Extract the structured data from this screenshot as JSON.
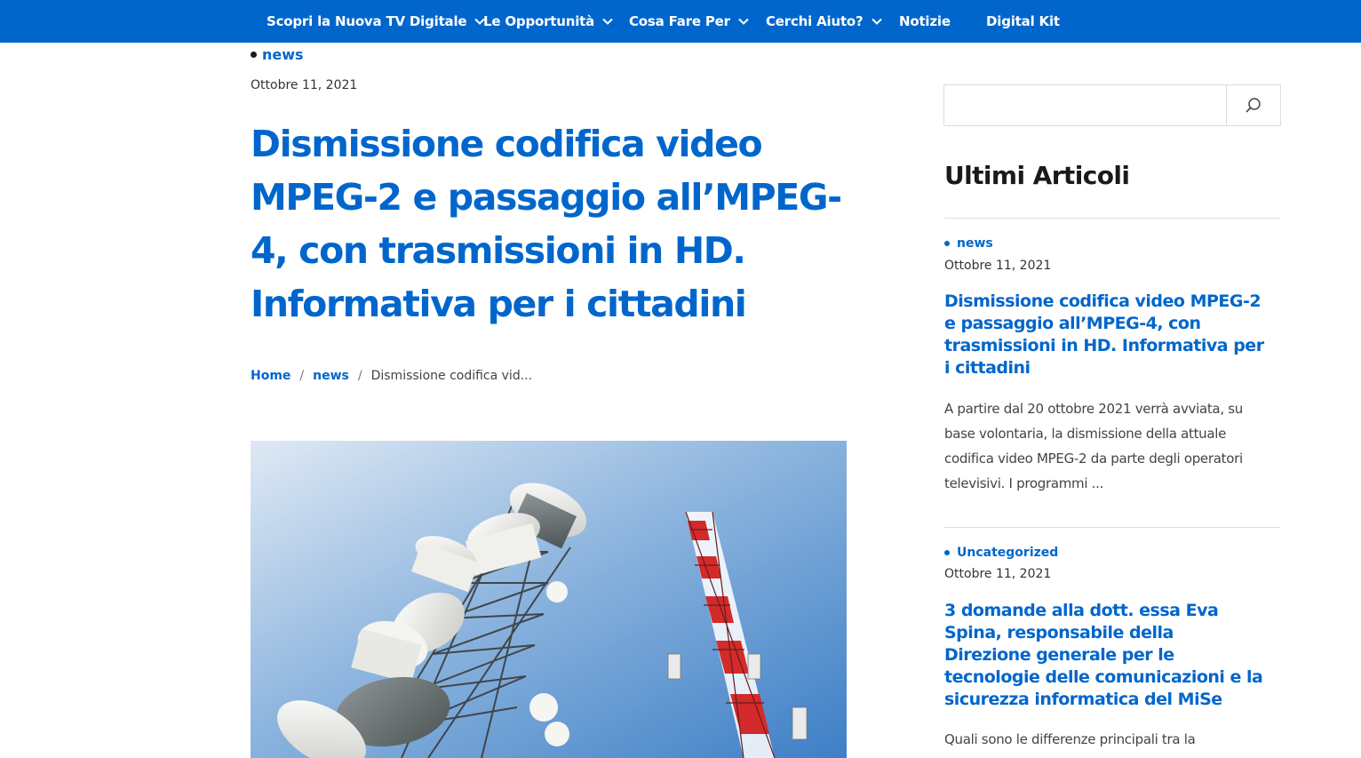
{
  "nav": {
    "items": [
      {
        "label": "Scopri la Nuova TV Digitale",
        "dropdown": true
      },
      {
        "label": "Le Opportunità",
        "dropdown": true
      },
      {
        "label": "Cosa Fare Per",
        "dropdown": true
      },
      {
        "label": "Cerchi Aiuto?",
        "dropdown": true
      },
      {
        "label": "Notizie",
        "dropdown": false
      },
      {
        "label": "Digital Kit",
        "dropdown": false
      }
    ],
    "color": "#0066cc"
  },
  "article": {
    "category": "news",
    "date": "Ottobre 11, 2021",
    "title": "Dismissione codifica video MPEG-2 e passaggio all’MPEG-4, con trasmissioni in HD. Informativa per i cittadini",
    "breadcrumb": {
      "home": "Home",
      "section": "news",
      "current": "Dismissione codifica vid..."
    },
    "image_icon": "telecom-towers-photo"
  },
  "sidebar": {
    "search": {
      "value": "",
      "placeholder": ""
    },
    "title": "Ultimi Articoli",
    "posts": [
      {
        "category": "news",
        "date": "Ottobre 11, 2021",
        "title": "Dismissione codifica video MPEG-2 e passaggio all’MPEG-4, con trasmissioni in HD. Informativa per i cittadini",
        "excerpt": "A partire dal 20 ottobre 2021 verrà avviata, su base volontaria, la dismissione della attuale codifica video MPEG-2 da parte degli operatori televisivi. I programmi ..."
      },
      {
        "category": "Uncategorized",
        "date": "Ottobre 11, 2021",
        "title": "3 domande alla dott. essa Eva Spina, responsabile della Direzione generale per le tecnologie delle comunicazioni e la sicurezza informatica del MiSe",
        "excerpt": "Quali sono le differenze principali tra la"
      }
    ]
  },
  "colors": {
    "accent": "#0066cc",
    "text": "#333333",
    "heading": "#1a1a1a"
  }
}
